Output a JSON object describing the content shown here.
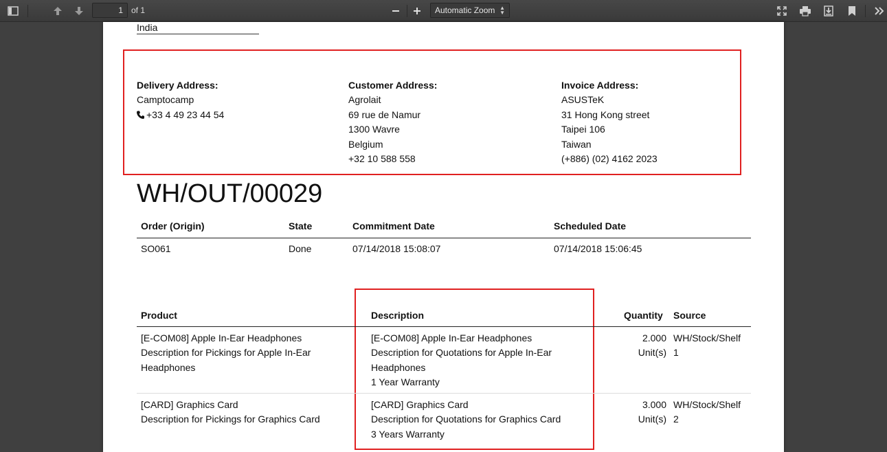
{
  "toolbar": {
    "page_number": "1",
    "page_of": "of 1",
    "zoom": "Automatic Zoom",
    "icons": [
      "sidebar-toggle-icon",
      "arrow-up-icon",
      "arrow-down-icon",
      "minus-icon",
      "plus-icon",
      "fullscreen-icon",
      "print-icon",
      "download-icon",
      "bookmark-icon",
      "tools-icon"
    ]
  },
  "document": {
    "country": "India",
    "delivery": {
      "heading": "Delivery Address:",
      "name": "Camptocamp",
      "phone": "+33 4 49 23 44 54"
    },
    "customer": {
      "heading": "Customer Address:",
      "lines": [
        "Agrolait",
        "69 rue de Namur",
        "1300 Wavre",
        "Belgium",
        "+32 10 588 558"
      ]
    },
    "invoice": {
      "heading": "Invoice Address:",
      "lines": [
        "ASUSTeK",
        "31 Hong Kong street",
        "Taipei 106",
        "Taiwan",
        "(+886) (02) 4162 2023"
      ]
    },
    "title": "WH/OUT/00029",
    "info": {
      "headers": [
        "Order (Origin)",
        "State",
        "Commitment Date",
        "Scheduled Date"
      ],
      "values": [
        "SO061",
        "Done",
        "07/14/2018 15:08:07",
        "07/14/2018 15:06:45"
      ]
    },
    "products": {
      "headers": [
        "Product",
        "Description",
        "Quantity",
        "Source"
      ],
      "rows": [
        {
          "product": [
            "[E-COM08] Apple In-Ear Headphones",
            "Description for Pickings for Apple In-Ear",
            "Headphones"
          ],
          "description": [
            "[E-COM08] Apple In-Ear Headphones",
            "Description for Quotations for Apple In-Ear",
            "Headphones",
            "1 Year Warranty"
          ],
          "quantity": [
            "2.000",
            "Unit(s)"
          ],
          "source": [
            "WH/Stock/Shelf",
            "1"
          ]
        },
        {
          "product": [
            "[CARD] Graphics Card",
            "Description for Pickings for Graphics Card"
          ],
          "description": [
            "[CARD] Graphics Card",
            "Description for Quotations for Graphics Card",
            "3 Years Warranty"
          ],
          "quantity": [
            "3.000",
            "Unit(s)"
          ],
          "source": [
            "WH/Stock/Shelf",
            "2"
          ]
        }
      ]
    }
  },
  "colors": {
    "highlight": "#e02020",
    "toolbar": "#404040"
  }
}
